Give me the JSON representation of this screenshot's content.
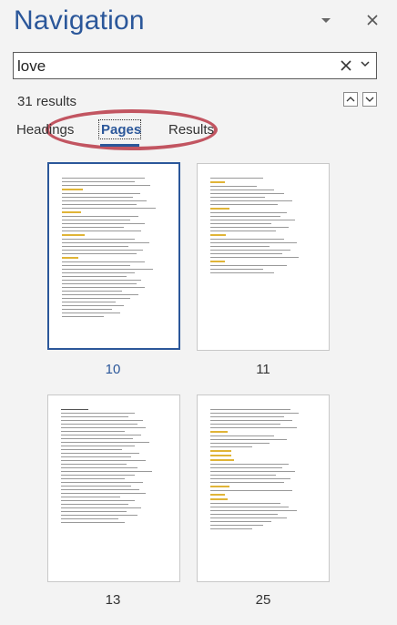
{
  "pane": {
    "title": "Navigation"
  },
  "search": {
    "value": "love"
  },
  "results": {
    "count_text": "31 results"
  },
  "tabs": [
    {
      "label": "Headings",
      "active": false
    },
    {
      "label": "Pages",
      "active": true
    },
    {
      "label": "Results",
      "active": false
    }
  ],
  "pages": [
    {
      "number": "10",
      "selected": true
    },
    {
      "number": "11",
      "selected": false
    },
    {
      "number": "13",
      "selected": false
    },
    {
      "number": "25",
      "selected": false
    }
  ],
  "icons": {
    "dropdown": "chevron-down-icon",
    "close": "close-icon",
    "clear": "clear-icon",
    "prev": "chevron-up-icon",
    "next": "chevron-down-icon"
  },
  "colors": {
    "accent": "#2b579a",
    "annotation": "#c25561",
    "highlight": "#e0b437"
  }
}
